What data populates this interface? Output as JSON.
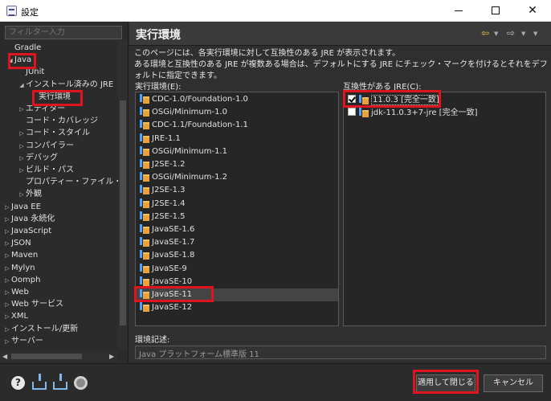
{
  "window": {
    "title": "設定"
  },
  "filter": {
    "placeholder": "フィルター入力"
  },
  "tree": {
    "items": [
      {
        "label": "Gradle",
        "toggle": ""
      },
      {
        "label": "Java",
        "toggle": "◢"
      },
      {
        "label": "JUnit",
        "toggle": ""
      },
      {
        "label": "インストール済みの JRE",
        "toggle": "◢"
      },
      {
        "label": "実行環境",
        "toggle": ""
      },
      {
        "label": "エディター",
        "toggle": "▷"
      },
      {
        "label": "コード・カバレッジ",
        "toggle": ""
      },
      {
        "label": "コード・スタイル",
        "toggle": "▷"
      },
      {
        "label": "コンパイラー",
        "toggle": "▷"
      },
      {
        "label": "デバッグ",
        "toggle": "▷"
      },
      {
        "label": "ビルド・パス",
        "toggle": "▷"
      },
      {
        "label": "プロパティー・ファイル・エディタ",
        "toggle": ""
      },
      {
        "label": "外観",
        "toggle": "▷"
      },
      {
        "label": "Java EE",
        "toggle": "▷"
      },
      {
        "label": "Java 永続化",
        "toggle": "▷"
      },
      {
        "label": "JavaScript",
        "toggle": "▷"
      },
      {
        "label": "JSON",
        "toggle": "▷"
      },
      {
        "label": "Maven",
        "toggle": "▷"
      },
      {
        "label": "Mylyn",
        "toggle": "▷"
      },
      {
        "label": "Oomph",
        "toggle": "▷"
      },
      {
        "label": "Web",
        "toggle": "▷"
      },
      {
        "label": "Web サービス",
        "toggle": "▷"
      },
      {
        "label": "XML",
        "toggle": "▷"
      },
      {
        "label": "インストール/更新",
        "toggle": "▷"
      },
      {
        "label": "サーバー",
        "toggle": "▷"
      }
    ]
  },
  "header": {
    "title": "実行環境"
  },
  "description": {
    "line1": "このページには、各実行環境に対して互換性のある JRE が表示されます。",
    "line2": "ある環境と互換性のある JRE が複数ある場合は、デフォルトにする JRE にチェック・マークを付けるとそれをデフォルトに指定できます。"
  },
  "environments": {
    "label": "実行環境(E):",
    "items": [
      "CDC-1.0/Foundation-1.0",
      "OSGi/Minimum-1.0",
      "CDC-1.1/Foundation-1.1",
      "JRE-1.1",
      "OSGi/Minimum-1.1",
      "J2SE-1.2",
      "OSGi/Minimum-1.2",
      "J2SE-1.3",
      "J2SE-1.4",
      "J2SE-1.5",
      "JavaSE-1.6",
      "JavaSE-1.7",
      "JavaSE-1.8",
      "JavaSE-9",
      "JavaSE-10",
      "JavaSE-11",
      "JavaSE-12"
    ]
  },
  "compatible": {
    "label": "互換性がある JRE(C):",
    "items": [
      {
        "label": "11.0.3 [完全一致]",
        "checked": true
      },
      {
        "label": "jdk-11.0.3+7-jre [完全一致]",
        "checked": false
      }
    ]
  },
  "env_description": {
    "label": "環境記述:",
    "value": "Java プラットフォーム標準版 11"
  },
  "buttons": {
    "apply_close": "適用して閉じる",
    "cancel": "キャンセル"
  },
  "colors": {
    "highlight": "#e0141e",
    "background": "#2f2f2f"
  }
}
